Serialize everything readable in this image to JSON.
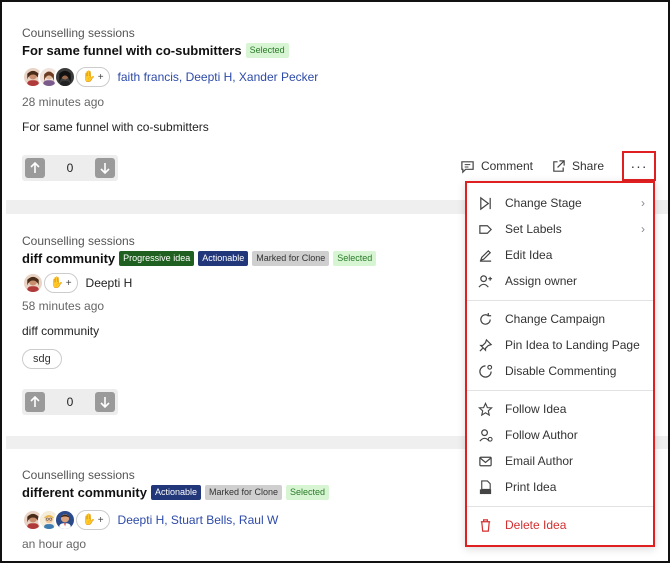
{
  "ideas": [
    {
      "category": "Counselling sessions",
      "title": "For same funnel with co-submitters",
      "tags": [
        "Selected"
      ],
      "authors": "faith francis, Deepti H, Xander Pecker",
      "time": "28 minutes ago",
      "description": "For same funnel with co-submitters",
      "votes": "0"
    },
    {
      "category": "Counselling sessions",
      "title": "diff community",
      "tags": [
        "Progressive idea",
        "Actionable",
        "Marked for Clone",
        "Selected"
      ],
      "authors": "Deepti H",
      "time": "58 minutes ago",
      "description": "diff community",
      "chip": "sdg",
      "votes": "0"
    },
    {
      "category": "Counselling sessions",
      "title": "different community",
      "tags": [
        "Actionable",
        "Marked for Clone",
        "Selected"
      ],
      "authors": "Deepti H, Stuart Bells, Raul W",
      "time": "an hour ago"
    }
  ],
  "reaction": {
    "plus": "+"
  },
  "actions": {
    "comment": "Comment",
    "share": "Share",
    "more": "···"
  },
  "menu": {
    "items": [
      {
        "label": "Change Stage",
        "icon": "stage-icon"
      },
      {
        "label": "Set Labels",
        "icon": "label-icon"
      },
      {
        "label": "Edit Idea",
        "icon": "pencil-icon"
      },
      {
        "label": "Assign owner",
        "icon": "user-plus-icon"
      },
      {
        "label": "Change Campaign",
        "icon": "refresh-icon"
      },
      {
        "label": "Pin Idea to Landing Page",
        "icon": "pin-icon"
      },
      {
        "label": "Disable Commenting",
        "icon": "comment-off-icon"
      },
      {
        "label": "Follow Idea",
        "icon": "star-icon"
      },
      {
        "label": "Follow Author",
        "icon": "user-follow-icon"
      },
      {
        "label": "Email Author",
        "icon": "mail-icon"
      },
      {
        "label": "Print Idea",
        "icon": "pdf-icon"
      },
      {
        "label": "Delete Idea",
        "icon": "trash-icon"
      }
    ],
    "chevron": "›"
  },
  "colors": {
    "accent": "#2d4aa8",
    "danger": "#d32f2f",
    "highlight": "#e02020"
  }
}
